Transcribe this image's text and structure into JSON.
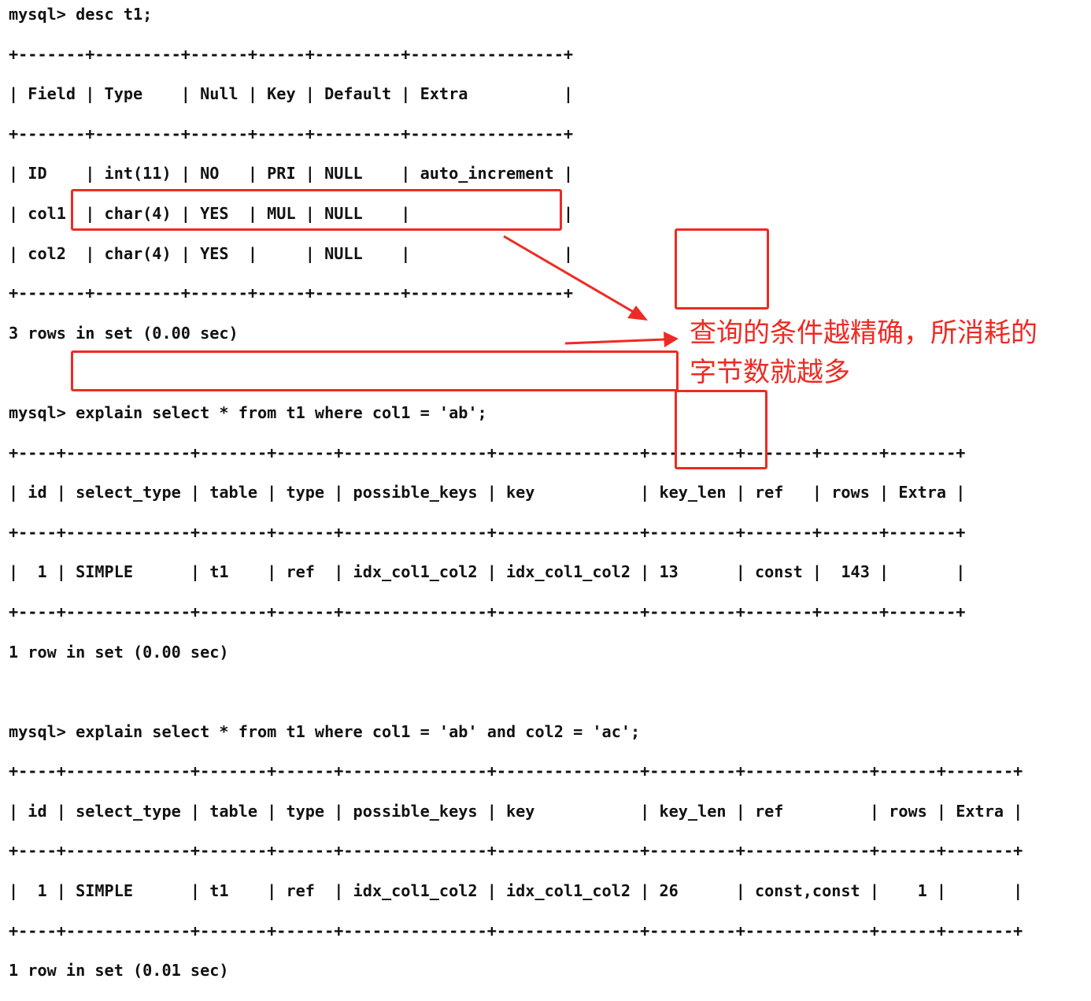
{
  "terminal": {
    "lines": [
      "mysql> desc t1;",
      "+-------+---------+------+-----+---------+----------------+",
      "| Field | Type    | Null | Key | Default | Extra          |",
      "+-------+---------+------+-----+---------+----------------+",
      "| ID    | int(11) | NO   | PRI | NULL    | auto_increment |",
      "| col1  | char(4) | YES  | MUL | NULL    |                |",
      "| col2  | char(4) | YES  |     | NULL    |                |",
      "+-------+---------+------+-----+---------+----------------+",
      "3 rows in set (0.00 sec)",
      "",
      "mysql> explain select * from t1 where col1 = 'ab';",
      "+----+-------------+-------+------+---------------+---------------+---------+-------+------+-------+",
      "| id | select_type | table | type | possible_keys | key           | key_len | ref   | rows | Extra |",
      "+----+-------------+-------+------+---------------+---------------+---------+-------+------+-------+",
      "|  1 | SIMPLE      | t1    | ref  | idx_col1_col2 | idx_col1_col2 | 13      | const |  143 |       |",
      "+----+-------------+-------+------+---------------+---------------+---------+-------+------+-------+",
      "1 row in set (0.00 sec)",
      "",
      "mysql> explain select * from t1 where col1 = 'ab' and col2 = 'ac';",
      "+----+-------------+-------+------+---------------+---------------+---------+-------------+------+-------+",
      "| id | select_type | table | type | possible_keys | key           | key_len | ref         | rows | Extra |",
      "+----+-------------+-------+------+---------------+---------------+---------+-------------+------+-------+",
      "|  1 | SIMPLE      | t1    | ref  | idx_col1_col2 | idx_col1_col2 | 26      | const,const |    1 |       |",
      "+----+-------------+-------+------+---------------+---------------+---------+-------------+------+-------+",
      "1 row in set (0.01 sec)"
    ]
  },
  "annotation": {
    "text": "查询的条件越精确，所消耗的\n字节数就越多",
    "color": "#ee2a24"
  }
}
